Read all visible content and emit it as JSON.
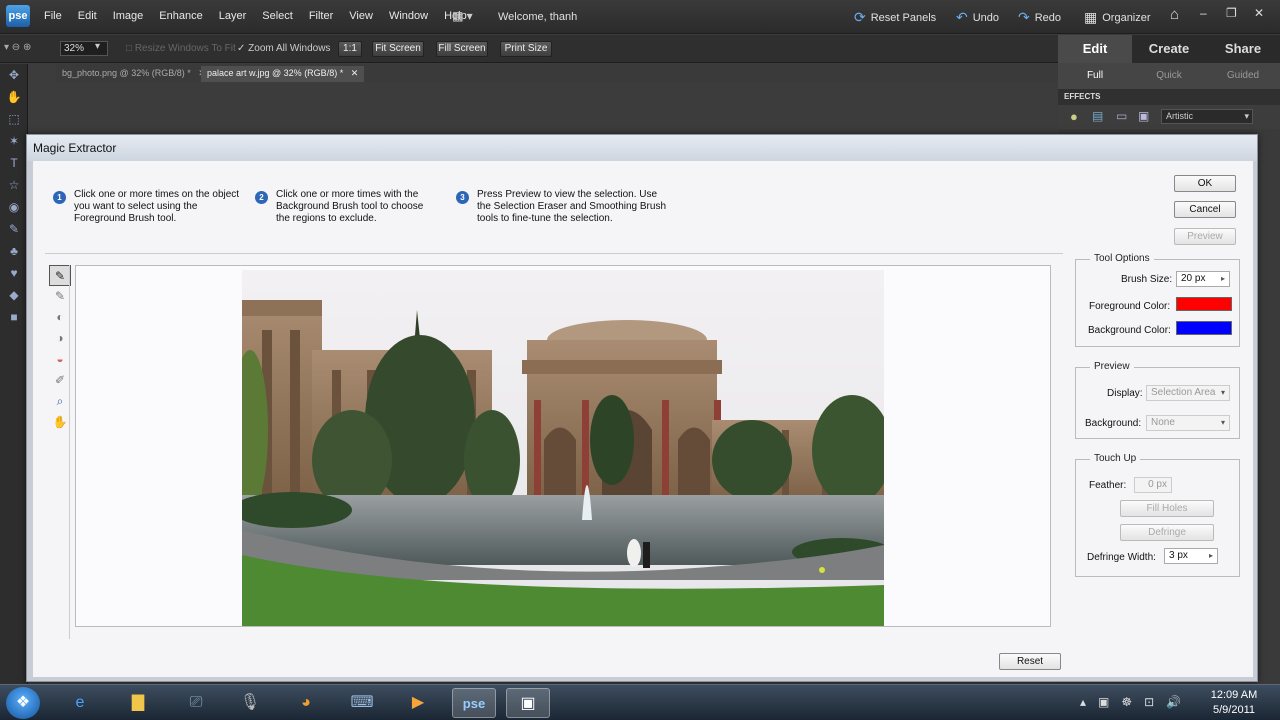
{
  "app": {
    "logo": "pse",
    "menu": [
      "File",
      "Edit",
      "Image",
      "Enhance",
      "Layer",
      "Select",
      "Filter",
      "View",
      "Window",
      "Help"
    ],
    "welcome": "Welcome, thanh",
    "reset_panels": "Reset Panels",
    "undo": "Undo",
    "redo": "Redo",
    "organizer": "Organizer"
  },
  "options_bar": {
    "zoom": "32%",
    "resize_windows": "Resize Windows To Fit",
    "zoom_all_windows": "Zoom All Windows",
    "one_to_one": "1:1",
    "fit_screen": "Fit Screen",
    "fill_screen": "Fill Screen",
    "print_size": "Print Size"
  },
  "doc_tabs": [
    {
      "label": "bg_photo.png @ 32% (RGB/8) *"
    },
    {
      "label": "palace art w.jpg @ 32% (RGB/8) *"
    }
  ],
  "right_panel": {
    "modes": [
      "Edit",
      "Create",
      "Share"
    ],
    "submodes": [
      "Full",
      "Quick",
      "Guided"
    ],
    "effects_title": "EFFECTS",
    "effects_category": "Artistic"
  },
  "dialog": {
    "title": "Magic Extractor",
    "steps": [
      {
        "num": "1",
        "text": "Click one or more times on the object you want to select using the Foreground Brush tool."
      },
      {
        "num": "2",
        "text": "Click one or more times with the Background Brush tool to choose the regions to exclude."
      },
      {
        "num": "3",
        "text": "Press Preview to view the selection. Use the Selection Eraser and Smoothing Brush tools to fine-tune the selection."
      }
    ],
    "ok": "OK",
    "cancel": "Cancel",
    "preview_button": "Preview",
    "reset": "Reset",
    "tool_options": {
      "title": "Tool Options",
      "brush_size_label": "Brush Size:",
      "brush_size": "20 px",
      "fg_label": "Foreground Color:",
      "fg_color": "#ff0000",
      "bg_label": "Background Color:",
      "bg_color": "#0000ff"
    },
    "preview": {
      "title": "Preview",
      "display_label": "Display:",
      "display": "Selection Area",
      "background_label": "Background:",
      "background": "None"
    },
    "touch_up": {
      "title": "Touch Up",
      "feather_label": "Feather:",
      "feather": "0 px",
      "fill_holes": "Fill Holes",
      "defringe": "Defringe",
      "defringe_width_label": "Defringe Width:",
      "defringe_width": "3 px"
    }
  },
  "taskbar": {
    "time": "12:09 AM",
    "date": "5/9/2011"
  }
}
